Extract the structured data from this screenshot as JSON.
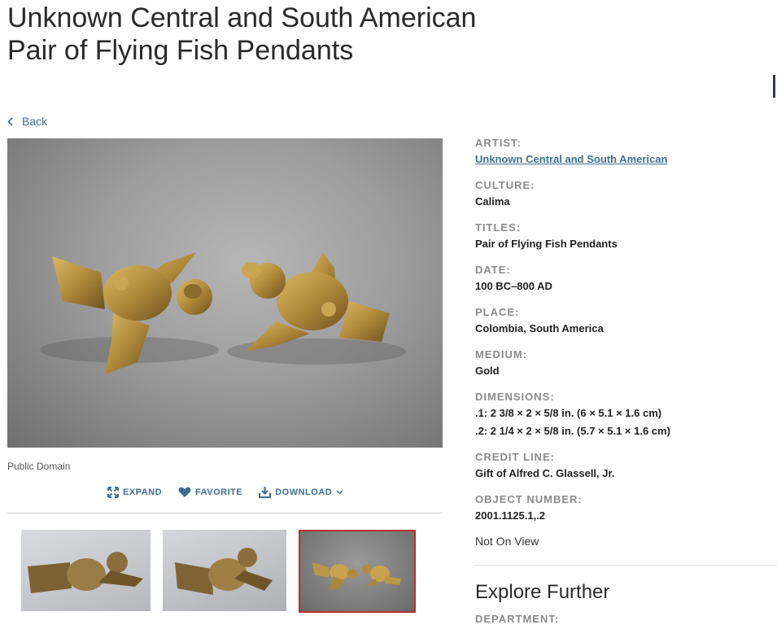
{
  "page": {
    "title_line1": "Unknown Central and South American",
    "title_line2": "Pair of Flying Fish Pendants"
  },
  "nav": {
    "back_label": "Back",
    "back_icon": "chevron-left-icon"
  },
  "image": {
    "license": "Public Domain",
    "actions": {
      "expand_label": "EXPAND",
      "favorite_label": "FAVORITE",
      "download_label": "DOWNLOAD"
    }
  },
  "metadata": {
    "artist_label": "ARTIST:",
    "artist_value": "Unknown Central and South American",
    "culture_label": "CULTURE:",
    "culture_value": "Calima",
    "titles_label": "TITLES:",
    "titles_value": "Pair of Flying Fish Pendants",
    "date_label": "DATE:",
    "date_value": "100 BC–800 AD",
    "place_label": "PLACE:",
    "place_value": "Colombia, South America",
    "medium_label": "MEDIUM:",
    "medium_value": "Gold",
    "dimensions_label": "DIMENSIONS:",
    "dimensions_line1": ".1: 2 3/8 × 2 × 5/8 in. (6 × 5.1 × 1.6 cm)",
    "dimensions_line2": ".2: 2 1/4 × 2 × 5/8 in. (5.7 × 5.1 × 1.6 cm)",
    "credit_label": "CREDIT LINE:",
    "credit_value": "Gift of Alfred C. Glassell, Jr.",
    "object_number_label": "OBJECT NUMBER:",
    "object_number_value": "2001.1125.1,.2"
  },
  "status": {
    "on_view": "Not On View"
  },
  "explore": {
    "heading": "Explore Further",
    "department_label": "DEPARTMENT:"
  },
  "colors": {
    "link": "#3d6f95",
    "selected_thumb_border": "#b8312f",
    "label_gray": "#8a8a8a"
  }
}
